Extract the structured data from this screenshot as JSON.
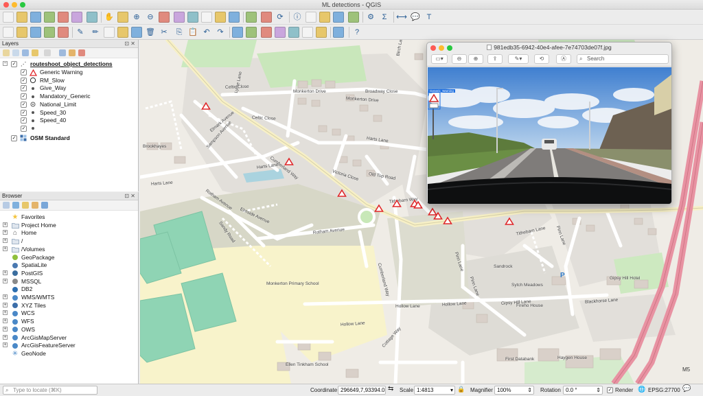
{
  "window": {
    "title": "ML detections - QGIS"
  },
  "toolbar": {
    "row1": [
      "new-project-icon",
      "open-project-icon",
      "save-project-icon",
      "save-as-icon",
      "print-layout-icon",
      "layout-manager-icon",
      "style-manager-icon",
      "pan-icon",
      "pan-to-selection-icon",
      "zoom-in-icon",
      "zoom-out-icon",
      "zoom-full-icon",
      "zoom-to-selection-icon",
      "zoom-to-layer-icon",
      "zoom-native-icon",
      "zoom-last-icon",
      "zoom-next-icon",
      "new-bookmark-icon",
      "show-bookmarks-icon",
      "refresh-icon",
      "identify-icon",
      "select-features-icon",
      "deselect-icon",
      "attribute-table-icon",
      "field-calculator-icon",
      "processing-toolbox-icon",
      "statistics-icon",
      "measure-icon",
      "map-tips-icon",
      "text-annotation-icon"
    ],
    "row2": [
      "data-source-manager-icon",
      "new-geopackage-icon",
      "new-shapefile-icon",
      "digitize-icon",
      "gps-icon",
      "edit-pencil-icon",
      "toggle-editing-icon",
      "save-edits-icon",
      "add-feature-icon",
      "vertex-tool-icon",
      "delete-selected-icon",
      "cut-features-icon",
      "copy-features-icon",
      "paste-features-icon",
      "undo-icon",
      "redo-icon",
      "label-toolbar-icon",
      "pin-labels-icon",
      "highlight-labels-icon",
      "show-hide-labels-icon",
      "move-label-icon",
      "rotate-label-icon",
      "change-label-icon",
      "python-console-icon",
      "help-icon"
    ]
  },
  "layers_panel": {
    "title": "Layers",
    "group": {
      "name": "routeshoot_object_detections",
      "checked": true
    },
    "items": [
      {
        "label": "Generic Warning",
        "symbol": "triangle"
      },
      {
        "label": "RM_Slow",
        "symbol": "circle"
      },
      {
        "label": "Give_Way",
        "symbol": "dot"
      },
      {
        "label": "Mandatory_Generic",
        "symbol": "dot"
      },
      {
        "label": "National_Limit",
        "symbol": "ring"
      },
      {
        "label": "Speed_30",
        "symbol": "dot"
      },
      {
        "label": "Speed_40",
        "symbol": "dot"
      },
      {
        "label": "",
        "symbol": "dot"
      }
    ],
    "basemap": {
      "name": "OSM Standard",
      "checked": true
    }
  },
  "browser_panel": {
    "title": "Browser",
    "items": [
      {
        "label": "Favorites",
        "icon": "star-icon",
        "expandable": false
      },
      {
        "label": "Project Home",
        "icon": "folder-icon",
        "expandable": true
      },
      {
        "label": "Home",
        "icon": "home-icon",
        "expandable": true
      },
      {
        "label": "/",
        "icon": "folder-icon",
        "expandable": true
      },
      {
        "label": "/Volumes",
        "icon": "folder-icon",
        "expandable": true
      },
      {
        "label": "GeoPackage",
        "icon": "geopackage-icon",
        "expandable": false
      },
      {
        "label": "SpatiaLite",
        "icon": "spatialite-icon",
        "expandable": false
      },
      {
        "label": "PostGIS",
        "icon": "postgis-icon",
        "expandable": true
      },
      {
        "label": "MSSQL",
        "icon": "mssql-icon",
        "expandable": true
      },
      {
        "label": "DB2",
        "icon": "db2-icon",
        "expandable": false
      },
      {
        "label": "WMS/WMTS",
        "icon": "wms-icon",
        "expandable": true
      },
      {
        "label": "XYZ Tiles",
        "icon": "xyz-tiles-icon",
        "expandable": true
      },
      {
        "label": "WCS",
        "icon": "wcs-icon",
        "expandable": true
      },
      {
        "label": "WFS",
        "icon": "wfs-icon",
        "expandable": true
      },
      {
        "label": "OWS",
        "icon": "ows-icon",
        "expandable": true
      },
      {
        "label": "ArcGisMapServer",
        "icon": "arcgis-icon",
        "expandable": true
      },
      {
        "label": "ArcGisFeatureServer",
        "icon": "arcgis-icon",
        "expandable": true
      },
      {
        "label": "GeoNode",
        "icon": "geonode-icon",
        "expandable": false
      }
    ]
  },
  "map": {
    "street_labels": [
      "Celtic Close",
      "Monkerton Drive",
      "Monkerton Drive",
      "Celtic Close",
      "Lythe Lane",
      "Elmark Avenue",
      "Sampson Avenue",
      "Cumberland Way",
      "Harts Lane",
      "Harts Lane",
      "Harts Lane",
      "Victoria Close",
      "Old Top Road",
      "Tithebarn Way",
      "Rotham Avenue",
      "Elmside Avenue",
      "Sandy Road",
      "Rotham Avenue",
      "Monkerton Primary School",
      "Cumberland Way",
      "Hollow Lane",
      "Hollow Lane",
      "Pinn Lane",
      "Gipsy Hill Lane",
      "Blackhorse Lane",
      "Sandrock",
      "Pinn Lane",
      "Tithebarn Lane",
      "Pinn Lane",
      "Hollow Lane",
      "Ellen Tinkham School",
      "Cottage Way",
      "Broadway Close",
      "Birch Lane",
      "Brookhayes",
      "First Databank",
      "Haygen House",
      "Fireho House",
      "Sytch Meadows",
      "Gipsy Hill Hotel",
      "Pinn Lane",
      "M5"
    ],
    "detections_count": 10
  },
  "viewer": {
    "title": "981edb35-6942-40e4-afee-7e74703de07f.jpg",
    "search_placeholder": "Search",
    "detection_label": "Generic_Warning"
  },
  "statusbar": {
    "locate_placeholder": "Type to locate (⌘K)",
    "coordinate_label": "Coordinate",
    "coordinate_value": "296649,7,93394.0",
    "scale_label": "Scale",
    "scale_value": "1:4813",
    "magnifier_label": "Magnifier",
    "magnifier_value": "100%",
    "rotation_label": "Rotation",
    "rotation_value": "0.0 °",
    "render_label": "Render",
    "render_checked": true,
    "crs_label": "EPSG:27700"
  },
  "colors": {
    "warning_red": "#e0272a",
    "motorway": "#e892a2",
    "park": "#c7e8bd",
    "pitch": "#88d2b0",
    "school": "#fdf6c3",
    "residential": "#e2e0db"
  }
}
